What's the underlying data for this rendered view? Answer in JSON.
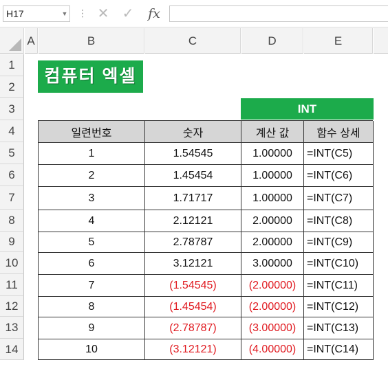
{
  "formula_bar": {
    "name_box": "H17",
    "cancel_icon": "✕",
    "enter_icon": "✓",
    "fx_label": "fx",
    "formula": ""
  },
  "columns": [
    "A",
    "B",
    "C",
    "D",
    "E"
  ],
  "rows": [
    "1",
    "2",
    "3",
    "4",
    "5",
    "6",
    "7",
    "8",
    "9",
    "10",
    "11",
    "12",
    "13",
    "14"
  ],
  "badge": {
    "text": "컴퓨터 엑셀"
  },
  "int_header": "INT",
  "table": {
    "headers": [
      "일련번호",
      "숫자",
      "계산 값",
      "함수 상세"
    ],
    "rows": [
      {
        "n": "1",
        "num": "1.54545",
        "val": "1.00000",
        "fn": "=INT(C5)",
        "neg": false
      },
      {
        "n": "2",
        "num": "1.45454",
        "val": "1.00000",
        "fn": "=INT(C6)",
        "neg": false
      },
      {
        "n": "3",
        "num": "1.71717",
        "val": "1.00000",
        "fn": "=INT(C7)",
        "neg": false
      },
      {
        "n": "4",
        "num": "2.12121",
        "val": "2.00000",
        "fn": "=INT(C8)",
        "neg": false
      },
      {
        "n": "5",
        "num": "2.78787",
        "val": "2.00000",
        "fn": "=INT(C9)",
        "neg": false
      },
      {
        "n": "6",
        "num": "3.12121",
        "val": "3.00000",
        "fn": "=INT(C10)",
        "neg": false
      },
      {
        "n": "7",
        "num": "(1.54545)",
        "val": "(2.00000)",
        "fn": "=INT(C11)",
        "neg": true
      },
      {
        "n": "8",
        "num": "(1.45454)",
        "val": "(2.00000)",
        "fn": "=INT(C12)",
        "neg": true
      },
      {
        "n": "9",
        "num": "(2.78787)",
        "val": "(3.00000)",
        "fn": "=INT(C13)",
        "neg": true
      },
      {
        "n": "10",
        "num": "(3.12121)",
        "val": "(4.00000)",
        "fn": "=INT(C14)",
        "neg": true
      }
    ]
  },
  "colors": {
    "green": "#1cab4b",
    "negative": "#e0191f",
    "header_fill": "#d6d6d6"
  }
}
